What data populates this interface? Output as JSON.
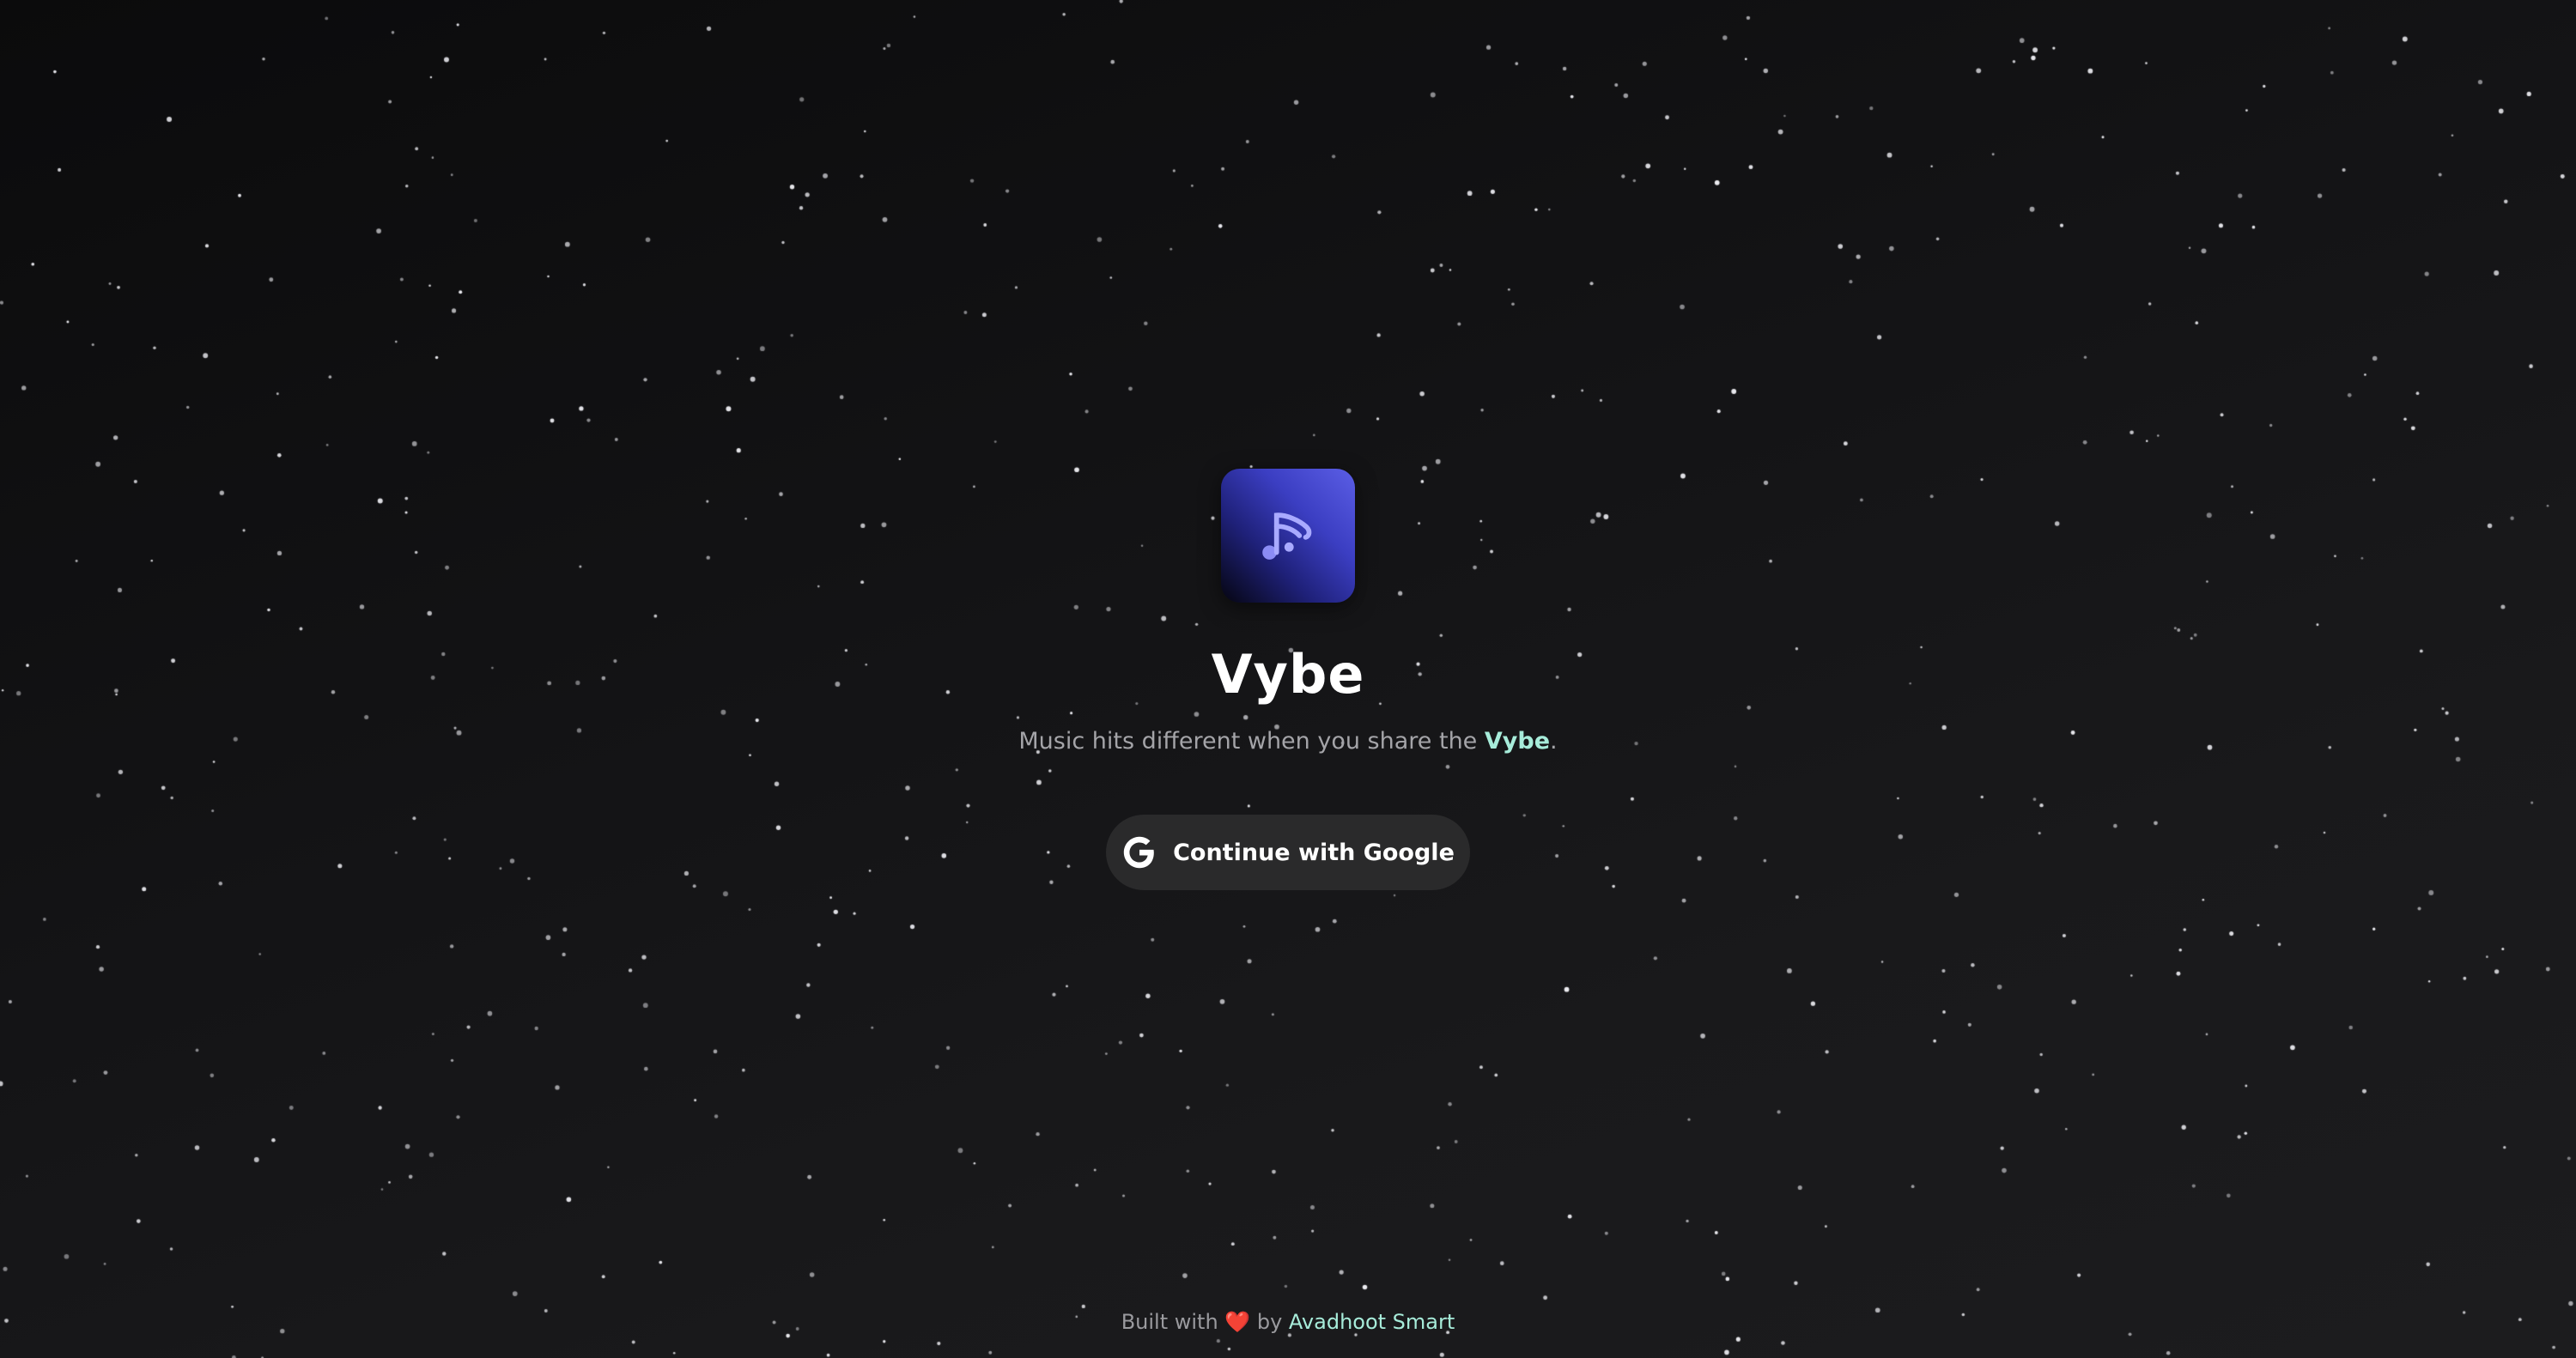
{
  "app": {
    "name": "Vybe",
    "icon": "music-note-icon"
  },
  "tagline": {
    "prefix": "Music hits different when you share the ",
    "brand": "Vybe",
    "suffix": "."
  },
  "login": {
    "button_label": "Continue with Google",
    "button_icon": "google-icon"
  },
  "footer": {
    "prefix": "Built with ",
    "heart": "❤️",
    "by": " by ",
    "author": "Avadhoot Smart"
  },
  "colors": {
    "background": "#111113",
    "accent": "#a7ecda",
    "icon_gradient_start": "#5b5ee6",
    "icon_gradient_end": "#050510",
    "button_bg": "#2a2a2b",
    "heart": "#e74c4c"
  }
}
